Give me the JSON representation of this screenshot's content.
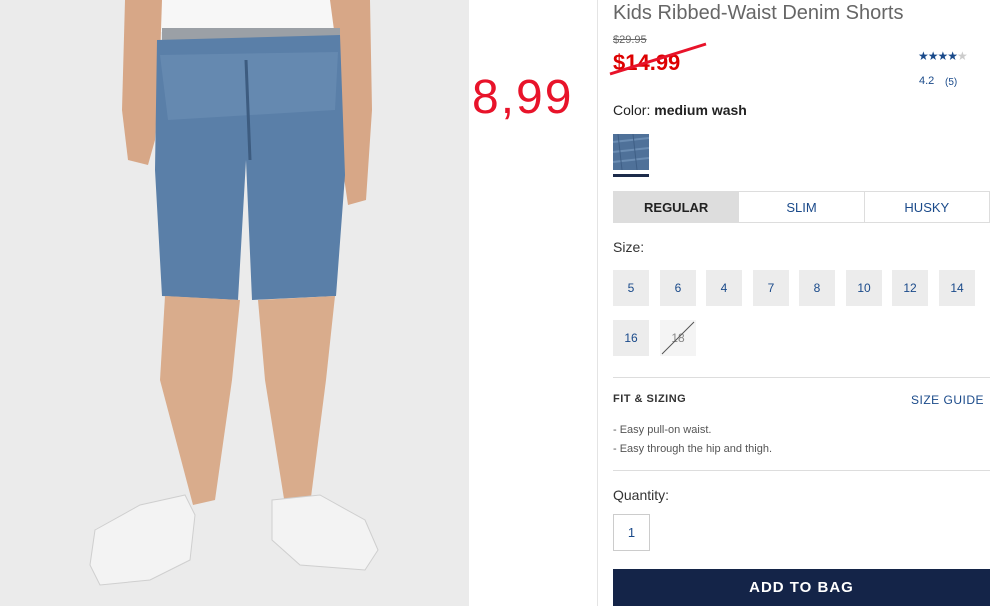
{
  "annotation": {
    "price_note": "8,99"
  },
  "product": {
    "title": "Kids Ribbed-Waist Denim Shorts",
    "original_price": "$29.95",
    "sale_price": "$14.99",
    "rating_stars": "★★★★",
    "rating_stars_empty": "★",
    "rating_value": "4.2",
    "review_count": "(5)",
    "color_label": "Color:",
    "color_value": "medium wash"
  },
  "fit_tabs": [
    {
      "label": "REGULAR",
      "active": true
    },
    {
      "label": "SLIM",
      "active": false
    },
    {
      "label": "HUSKY",
      "active": false
    }
  ],
  "sizes": {
    "label": "Size:",
    "items": [
      {
        "label": "5",
        "available": true
      },
      {
        "label": "6",
        "available": true
      },
      {
        "label": "4",
        "available": true
      },
      {
        "label": "7",
        "available": true
      },
      {
        "label": "8",
        "available": true
      },
      {
        "label": "10",
        "available": true
      },
      {
        "label": "12",
        "available": true
      },
      {
        "label": "14",
        "available": true
      },
      {
        "label": "16",
        "available": true
      },
      {
        "label": "18",
        "available": false
      }
    ]
  },
  "fit_sizing": {
    "heading": "FIT & SIZING",
    "guide_link": "SIZE GUIDE",
    "bullets": [
      "- Easy pull-on waist.",
      "- Easy through the hip and thigh."
    ]
  },
  "quantity": {
    "label": "Quantity:",
    "value": "1"
  },
  "cta": {
    "add_to_bag": "ADD TO BAG"
  },
  "colors": {
    "accent": "#1a4a8a",
    "sale_red": "#d00000",
    "button_navy": "#142448",
    "annotation_red": "#e8132a"
  }
}
